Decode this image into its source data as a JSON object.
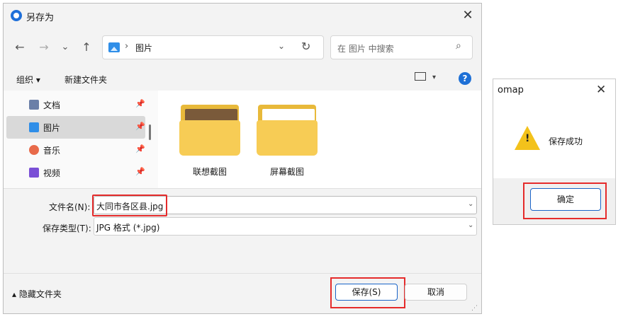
{
  "save_dialog": {
    "title": "另存为",
    "close_glyph": "✕",
    "nav": {
      "back_glyph": "←",
      "forward_glyph": "→",
      "recent_glyph": "⌄",
      "up_glyph": "↑"
    },
    "address": {
      "separator": "›",
      "location": "图片",
      "dropdown_glyph": "⌄",
      "refresh_glyph": "↻"
    },
    "search": {
      "placeholder": "在 图片 中搜索",
      "icon_glyph": "⌕"
    },
    "toolbar": {
      "organize_label": "组织 ▾",
      "new_folder_label": "新建文件夹",
      "view_caret": "▾",
      "help_glyph": "?"
    },
    "nav_items": [
      {
        "label": "文档",
        "icon": "document-icon",
        "color": "#6b7fa8",
        "pinned": true
      },
      {
        "label": "图片",
        "icon": "pictures-icon",
        "color": "#2f8ee8",
        "pinned": true,
        "selected": true
      },
      {
        "label": "音乐",
        "icon": "music-icon",
        "color": "#e86a4a",
        "pinned": true
      },
      {
        "label": "视频",
        "icon": "video-icon",
        "color": "#7a4fd6",
        "pinned": true
      }
    ],
    "pin_glyph": "📌",
    "folders": [
      {
        "label": "联想截图"
      },
      {
        "label": "屏幕截图"
      }
    ],
    "form": {
      "filename_label": "文件名(N):",
      "filename_value": "大同市各区县.jpg",
      "filetype_label": "保存类型(T):",
      "filetype_value": "JPG 格式 (*.jpg)",
      "caret_glyph": "⌄"
    },
    "footer": {
      "hide_folders_label": "▴  隐藏文件夹",
      "save_label": "保存(S)",
      "cancel_label": "取消",
      "grip_glyph": "⋰"
    }
  },
  "message_box": {
    "title": "omap",
    "close_glyph": "✕",
    "warning_mark": "!",
    "message": "保存成功",
    "ok_label": "确定"
  },
  "colors": {
    "accent_blue": "#1a64c8",
    "highlight_red": "#e52b2b",
    "folder_yellow": "#f7cc55",
    "warning_yellow": "#f3c21b"
  }
}
